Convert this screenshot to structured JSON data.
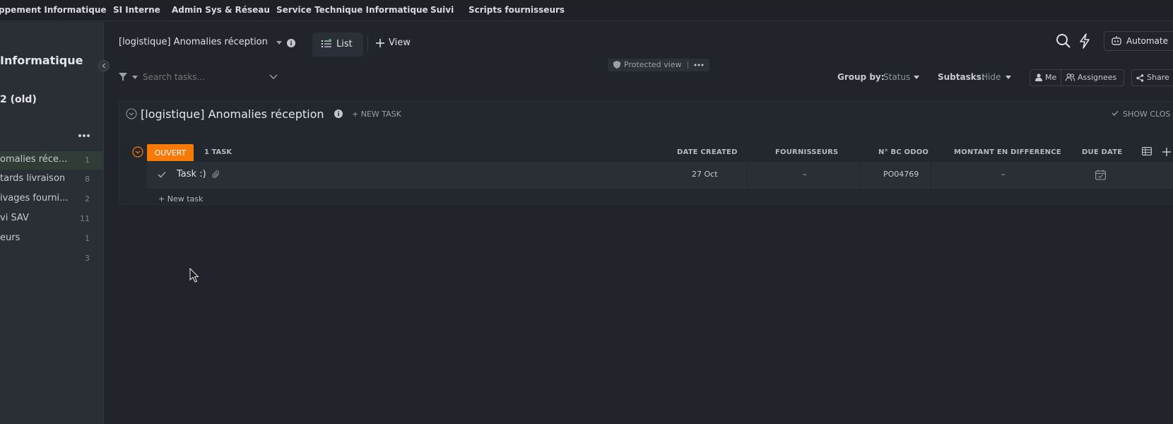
{
  "topnav": {
    "items": [
      "ppement Informatique",
      "SI Interne",
      "Admin Sys & Réseau",
      "Service Technique Informatique",
      "Suivi",
      "Scripts fournisseurs"
    ]
  },
  "sidebar": {
    "space_title": "Informatique",
    "folder_title": "2 (old)",
    "items": [
      {
        "label": "omalies réce...",
        "count": "1"
      },
      {
        "label": "tards livraison",
        "count": "8"
      },
      {
        "label": "ivages fourni...",
        "count": "2"
      },
      {
        "label": "vi SAV",
        "count": "11"
      },
      {
        "label": "eurs",
        "count": "1"
      },
      {
        "label": "",
        "count": "3"
      }
    ]
  },
  "header": {
    "list_name": "[logistique] Anomalies réception",
    "tab_list": "List",
    "add_view": "View",
    "automate": "Automate",
    "protected_view": "Protected view"
  },
  "toolbar": {
    "search_placeholder": "Search tasks...",
    "group_by_label": "Group by:",
    "group_by_value": "Status",
    "subtasks_label": "Subtasks:",
    "subtasks_value": "Hide",
    "me": "Me",
    "assignees": "Assignees",
    "share": "Share"
  },
  "list": {
    "title": "[logistique] Anomalies réception",
    "new_task": "+ NEW TASK",
    "show_closed": "SHOW CLOS",
    "group": {
      "status": "OUVERT",
      "status_color": "#f77a08",
      "count": "1 TASK"
    },
    "columns": [
      "DATE CREATED",
      "FOURNISSEURS",
      "N° BC ODOO",
      "MONTANT EN DIFFERENCE",
      "DUE DATE"
    ],
    "tasks": [
      {
        "name": "Task :)",
        "date_created": "27 Oct",
        "fournisseurs": "–",
        "bc_odoo": "PO04769",
        "montant": "–"
      }
    ],
    "add_task": "+ New task"
  },
  "colors": {
    "accent_orange": "#f77a08",
    "background": "#21252b",
    "sidebar_bg": "#2a2f36"
  }
}
